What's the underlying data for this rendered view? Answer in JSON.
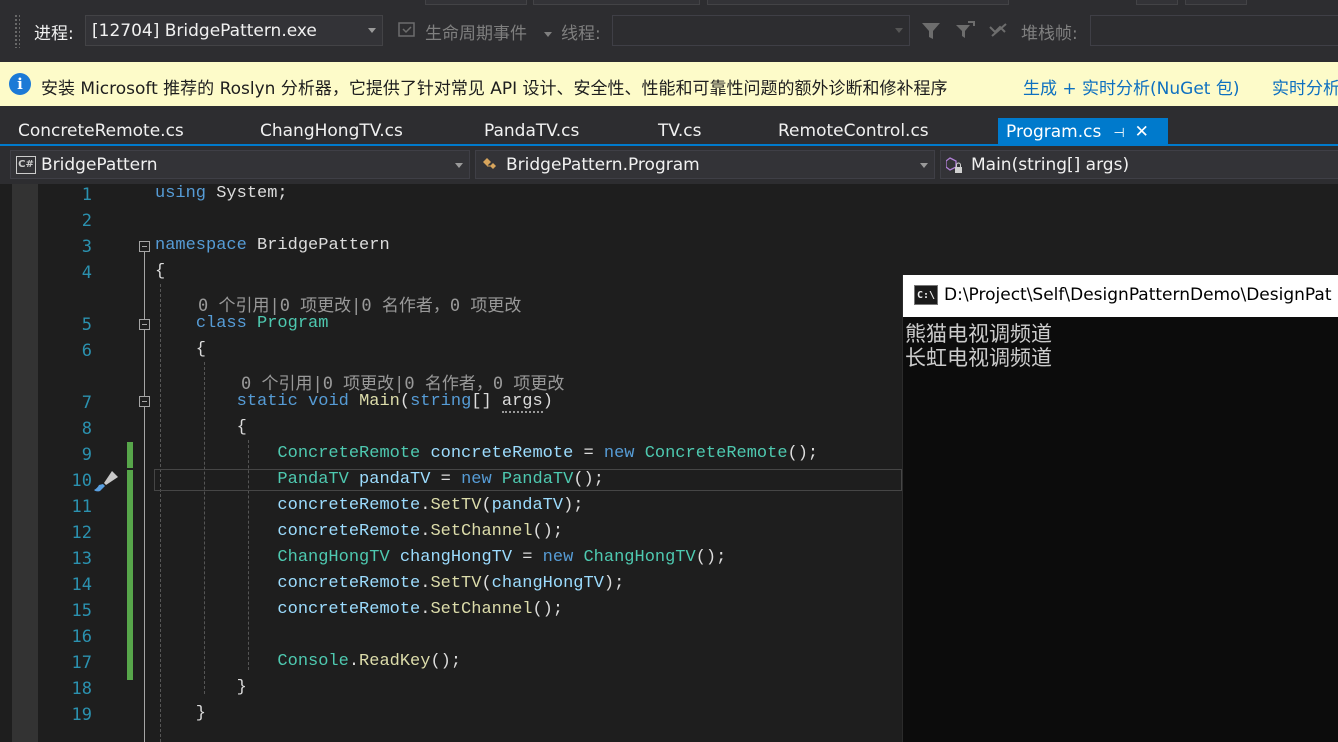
{
  "toolbar": {
    "process_label": "进程:",
    "process_value": "[12704] BridgePattern.exe",
    "lifecycle_label": "生命周期事件",
    "thread_label": "线程:",
    "thread_value": "",
    "stackframe_label": "堆栈帧:"
  },
  "infobar": {
    "message": "安装 Microsoft 推荐的 Roslyn 分析器，它提供了针对常见 API 设计、安全性、性能和可靠性问题的额外诊断和修补程序",
    "link1": "生成 + 实时分析(NuGet 包)",
    "link2": "实时分析"
  },
  "tabs": [
    {
      "label": "ConcreteRemote.cs"
    },
    {
      "label": "ChangHongTV.cs"
    },
    {
      "label": "PandaTV.cs"
    },
    {
      "label": "TV.cs"
    },
    {
      "label": "RemoteControl.cs"
    },
    {
      "label": "Program.cs",
      "active": true
    }
  ],
  "navbar": {
    "project": "BridgePattern",
    "type": "BridgePattern.Program",
    "member": "Main(string[] args)"
  },
  "editor": {
    "line_numbers": [
      "1",
      "2",
      "3",
      "4",
      "5",
      "6",
      "7",
      "8",
      "9",
      "10",
      "11",
      "12",
      "13",
      "14",
      "15",
      "16",
      "17",
      "18",
      "19"
    ],
    "codelens": "0 个引用|0 项更改|0 名作者，0 项更改"
  },
  "console": {
    "title": "D:\\Project\\Self\\DesignPatternDemo\\DesignPat",
    "icon_text": "C:\\",
    "output": [
      "熊猫电视调频道",
      "长虹电视调频道"
    ]
  },
  "colors": {
    "accent": "#007acc",
    "keyword": "#569cd6",
    "type": "#4ec9b0",
    "method": "#dcdcaa",
    "identifier": "#9cdcfe",
    "change_bar": "#57a64a"
  }
}
